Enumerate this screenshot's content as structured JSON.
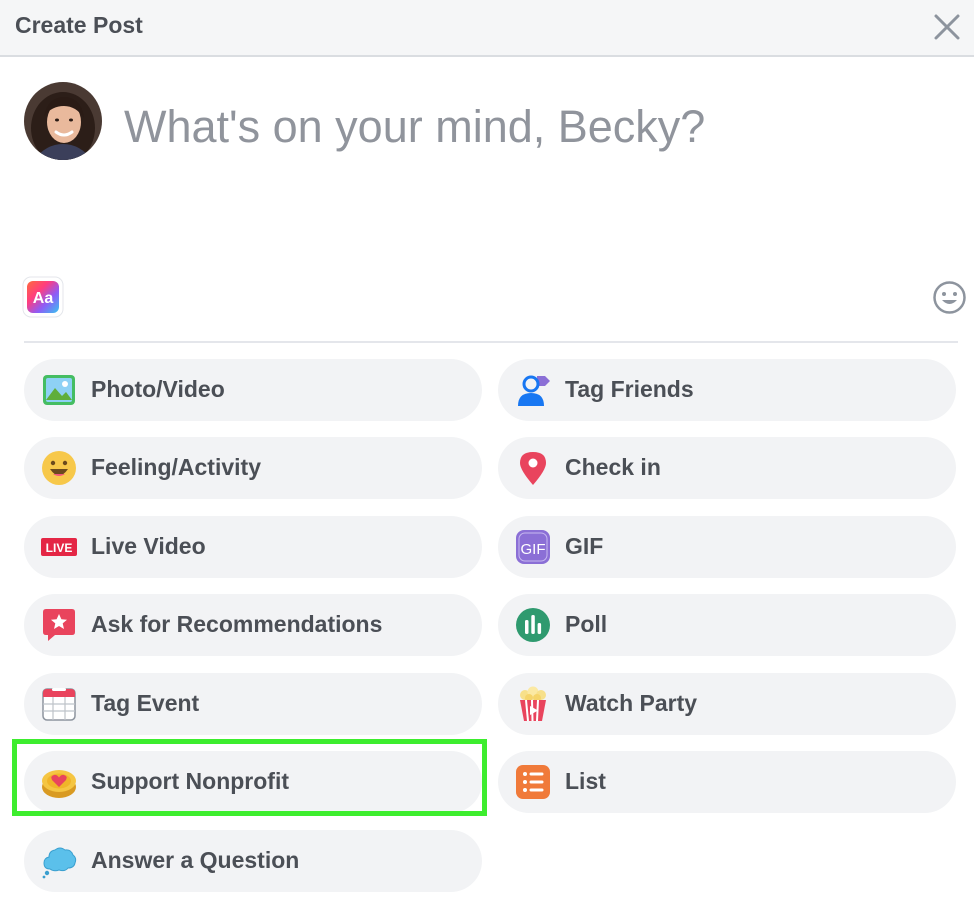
{
  "header": {
    "title": "Create Post"
  },
  "composer": {
    "placeholder": "What's on your mind, Becky?"
  },
  "options": {
    "left": [
      {
        "label": "Photo/Video",
        "icon": "photo-icon"
      },
      {
        "label": "Feeling/Activity",
        "icon": "smiley-face-icon"
      },
      {
        "label": "Live Video",
        "icon": "live-badge-icon",
        "badge": "LIVE"
      },
      {
        "label": "Ask for Recommendations",
        "icon": "recommendation-star-bubble-icon"
      },
      {
        "label": "Tag Event",
        "icon": "calendar-icon"
      },
      {
        "label": "Support Nonprofit",
        "icon": "heart-coin-icon"
      },
      {
        "label": "Answer a Question",
        "icon": "thought-cloud-icon"
      }
    ],
    "right": [
      {
        "label": "Tag Friends",
        "icon": "tag-person-icon"
      },
      {
        "label": "Check in",
        "icon": "map-pin-icon"
      },
      {
        "label": "GIF",
        "icon": "gif-icon",
        "badge": "GIF"
      },
      {
        "label": "Poll",
        "icon": "poll-bars-icon"
      },
      {
        "label": "Watch Party",
        "icon": "popcorn-icon"
      },
      {
        "label": "List",
        "icon": "list-icon"
      }
    ]
  },
  "highlight_color": "#3ded2e"
}
